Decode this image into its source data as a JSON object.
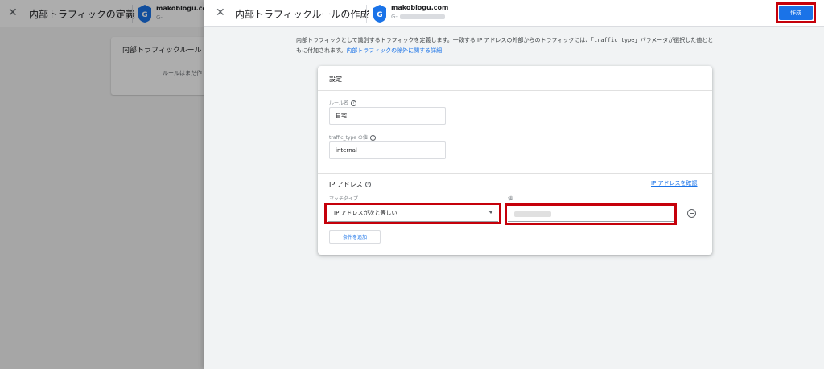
{
  "background": {
    "close_label": "✕",
    "title": "内部トラフィックの定義",
    "account_name": "makoblogu.com",
    "account_id": "G-",
    "card_title": "内部トラフィックルール",
    "card_message": "ルールはまだ作"
  },
  "drawer": {
    "close_label": "✕",
    "title": "内部トラフィックルールの作成",
    "account_name": "makoblogu.com",
    "account_id": "G-",
    "create_label": "作成",
    "description_part1": "内部トラフィックとして識別するトラフィックを定義します。一致する IP アドレスの外部からのトラフィックには、「",
    "description_code": "traffic_type",
    "description_part2": "」パラメータが選択した値とともに付加されます。",
    "description_link": "内部トラフィックの除外に関する詳細"
  },
  "settings": {
    "title": "設定",
    "rule_name_label": "ルール名",
    "rule_name_value": "自宅",
    "traffic_type_label": "traffic_type の値",
    "traffic_type_value": "internal",
    "ip_title": "IP アドレス",
    "ip_confirm_link": "IP アドレスを確認",
    "match_type_label": "マッチタイプ",
    "match_type_value": "IP アドレスが次と等しい",
    "value_label": "値",
    "add_condition_label": "条件を追加"
  },
  "colors": {
    "accent": "#1a73e8",
    "highlight": "#c5000a"
  },
  "icons": {
    "logo": "analytics-tag-icon",
    "help": "help-circle-icon",
    "remove": "remove-circle-icon",
    "dropdown": "caret-down-icon"
  }
}
